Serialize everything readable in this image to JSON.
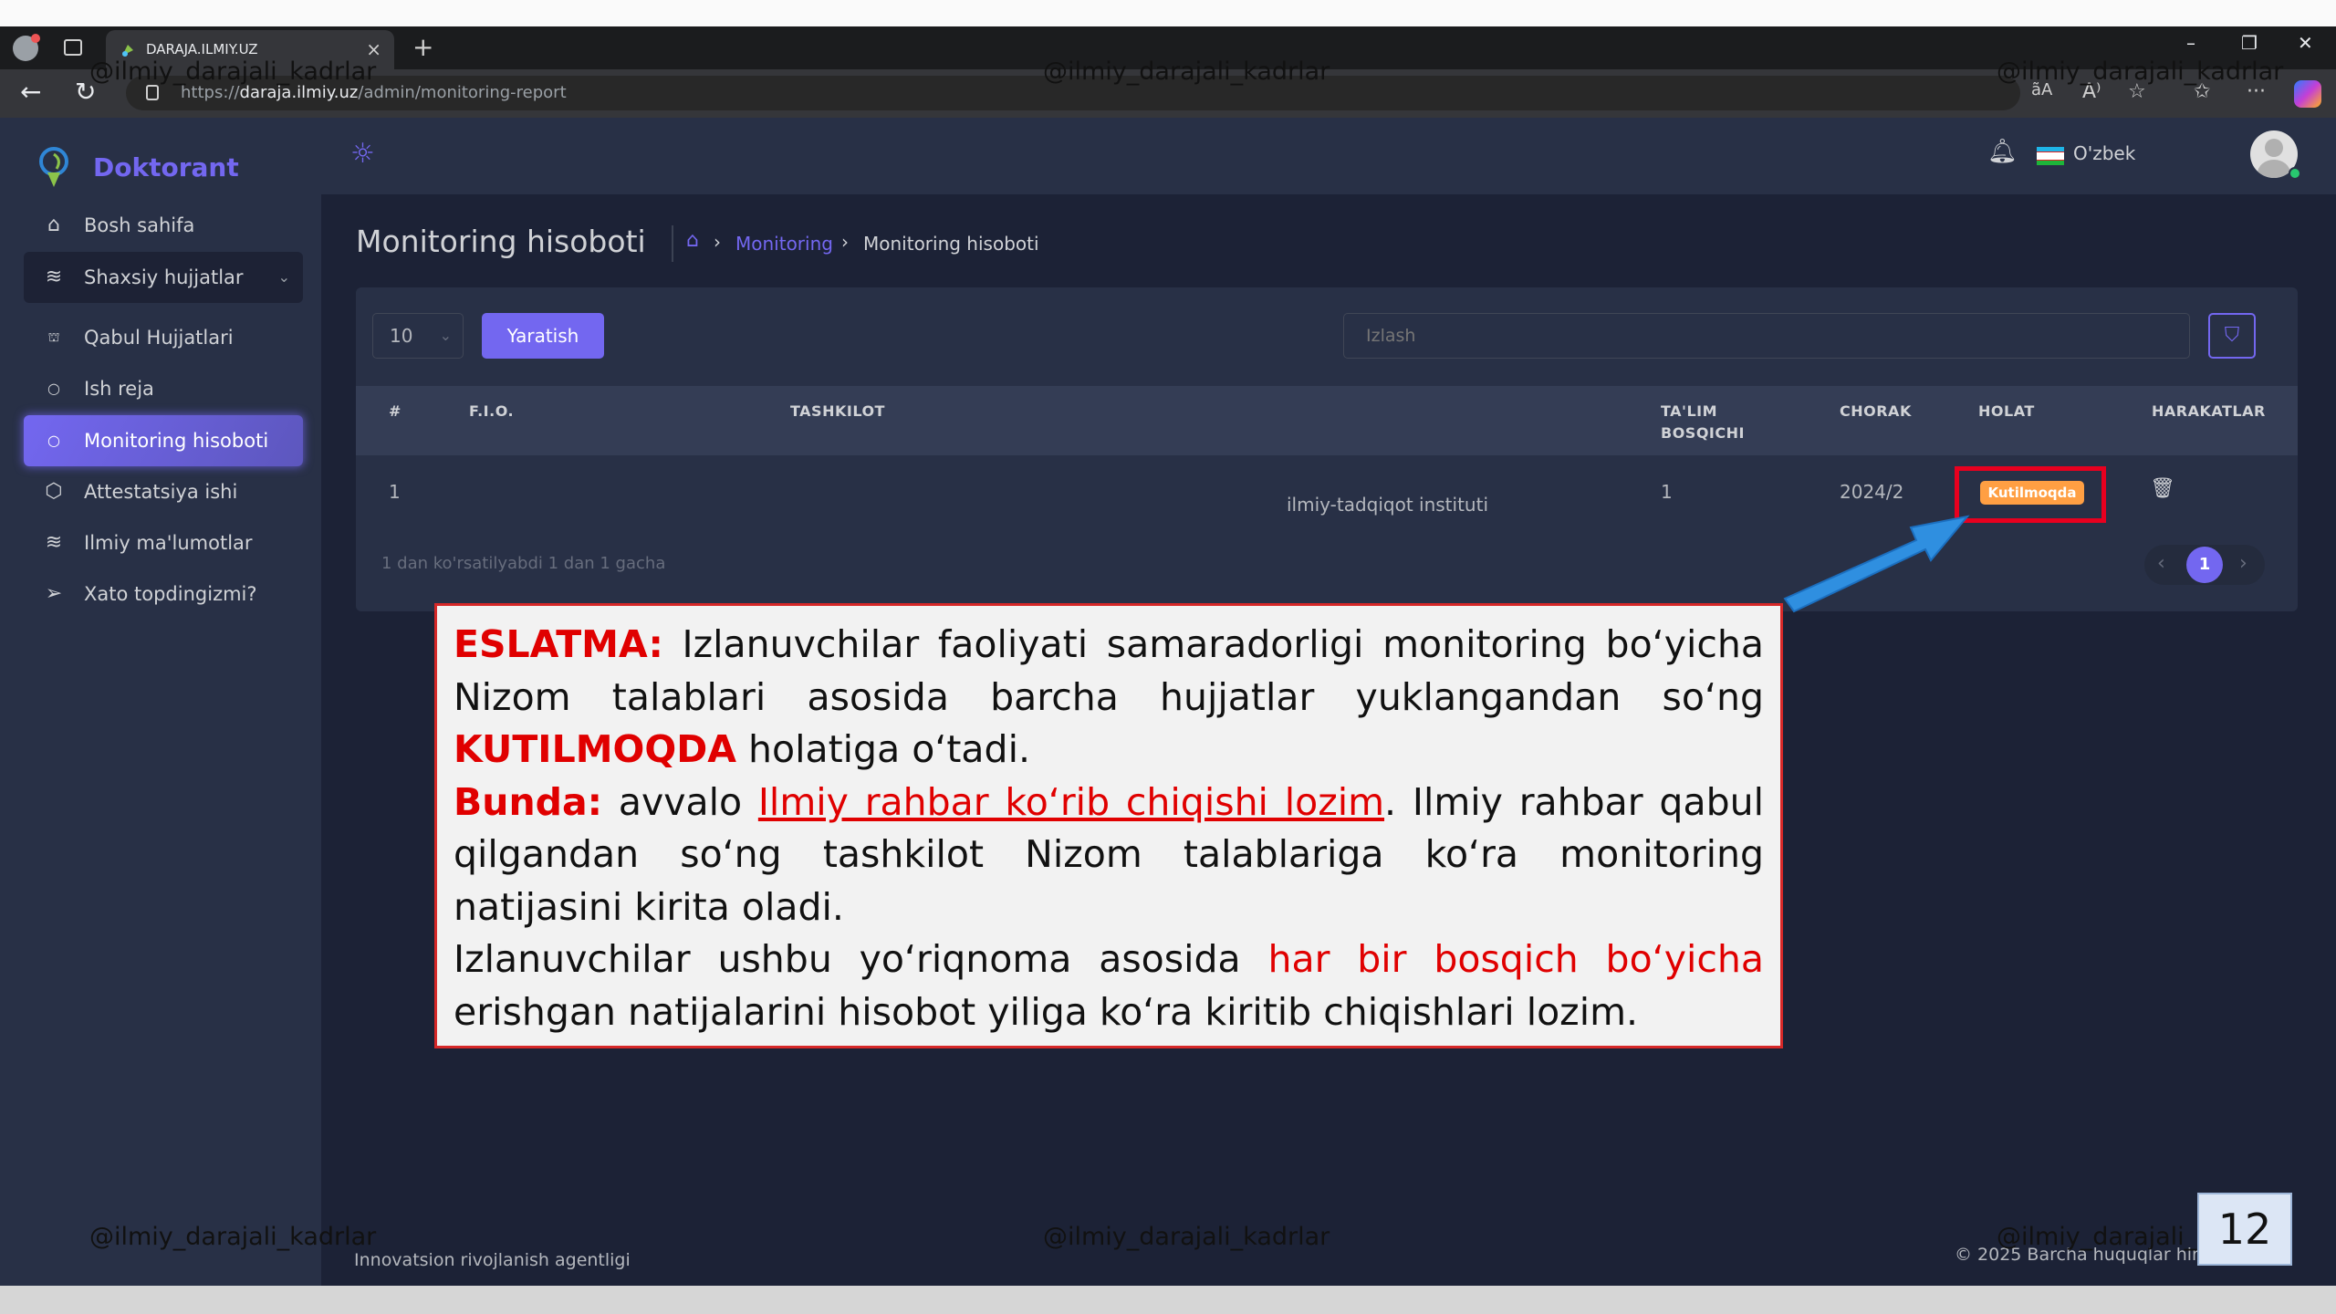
{
  "browser": {
    "tab_title": "DARAJA.ILMIY.UZ",
    "tab_close": "×",
    "new_tab": "+",
    "url_prefix": "https://",
    "url_host": "daraja.ilmiy.uz",
    "url_path": "/admin/monitoring-report"
  },
  "sidebar": {
    "brand": "Doktorant",
    "items": [
      {
        "label": "Bosh sahifa",
        "icon": "home-icon"
      },
      {
        "label": "Shaxsiy hujjatlar",
        "icon": "layers-icon"
      },
      {
        "label": "Qabul Hujjatlari",
        "icon": "building-icon"
      },
      {
        "label": "Ish reja",
        "icon": "circle-icon"
      },
      {
        "label": "Monitoring hisoboti",
        "icon": "circle-icon"
      },
      {
        "label": "Attestatsiya ishi",
        "icon": "hexagon-icon"
      },
      {
        "label": "Ilmiy ma'lumotlar",
        "icon": "layers-icon"
      },
      {
        "label": "Xato topdingizmi?",
        "icon": "send-icon"
      }
    ],
    "active_index": 4,
    "active_color": "#7367f0"
  },
  "topbar": {
    "language": "O'zbek"
  },
  "page": {
    "title": "Monitoring hisoboti",
    "breadcrumb_link": "Monitoring",
    "breadcrumb_current": "Monitoring hisoboti"
  },
  "table": {
    "per_page": "10",
    "create_label": "Yaratish",
    "search_placeholder": "Izlash",
    "headers": {
      "num": "#",
      "fio": "F.I.O.",
      "org": "TASHKILOT",
      "stage_1": "TA'LIM",
      "stage_2": "BOSQICHI",
      "quarter": "CHORAK",
      "status": "HOLAT",
      "actions": "HARAKATLAR"
    },
    "rows": [
      {
        "num": "1",
        "fio": "",
        "org": "ilmiy-tadqiqot instituti",
        "stage": "1",
        "quarter": "2024/2",
        "status": "Kutilmoqda",
        "status_color": "#ff9f43"
      }
    ],
    "showing_text": "1 dan ko'rsatilyabdi 1 dan 1 gacha",
    "current_page": "1"
  },
  "footer": {
    "left": "Innovatsion rivojlanish agentligi",
    "right": "© 2025 Barcha huquqlar hin"
  },
  "note": {
    "p1_label": "ESLATMA:",
    "p1_text_a": " Izlanuvchilar faoliyati samaradorligi monitoring bo‘yicha Nizom talablari asosida barcha hujjatlar yuklangandan so‘ng ",
    "p1_highlight": "KUTILMOQDA",
    "p1_text_b": " holatiga o‘tadi.",
    "p2_label": "Bunda:",
    "p2_text_a": " avvalo ",
    "p2_underlined": "Ilmiy rahbar ko‘rib chiqishi lozim",
    "p2_text_b": ". Ilmiy rahbar qabul qilgandan so‘ng tashkilot Nizom talablariga ko‘ra monitoring natijasini kirita oladi.",
    "p3_text_a": "Izlanuvchilar ushbu yo‘riqnoma asosida ",
    "p3_highlight": "har bir bosqich bo‘yicha",
    "p3_text_b": " erishgan natijalarini hisobot yiliga ko‘ra kiritib chiqishlari lozim."
  },
  "watermark": "@ilmiy_darajali_kadrlar",
  "slide_number": "12"
}
